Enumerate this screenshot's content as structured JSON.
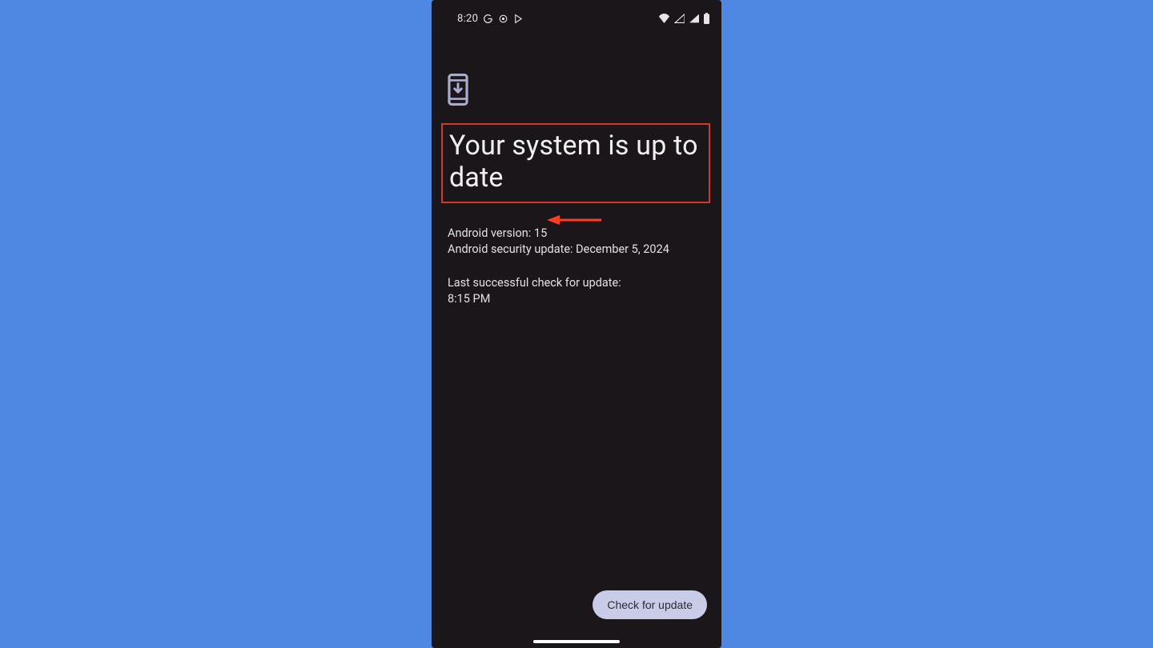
{
  "status_bar": {
    "time": "8:20",
    "left_icons": [
      "google-g-icon",
      "target-icon",
      "play-store-icon"
    ],
    "right_icons": [
      "wifi-icon",
      "signal-empty-icon",
      "signal-icon",
      "battery-icon"
    ]
  },
  "header": {
    "icon": "phone-download-icon",
    "title": "Your system is up to date"
  },
  "details": {
    "android_version_label": "Android version: ",
    "android_version_value": "15",
    "security_update_label": "Android security update: ",
    "security_update_value": "December 5, 2024",
    "last_check_label": "Last successful check for update:",
    "last_check_time": "8:15 PM"
  },
  "actions": {
    "check_update_label": "Check for update"
  },
  "annotations": {
    "highlight_color": "#d13b23",
    "arrow_color": "#ff3d1f"
  }
}
